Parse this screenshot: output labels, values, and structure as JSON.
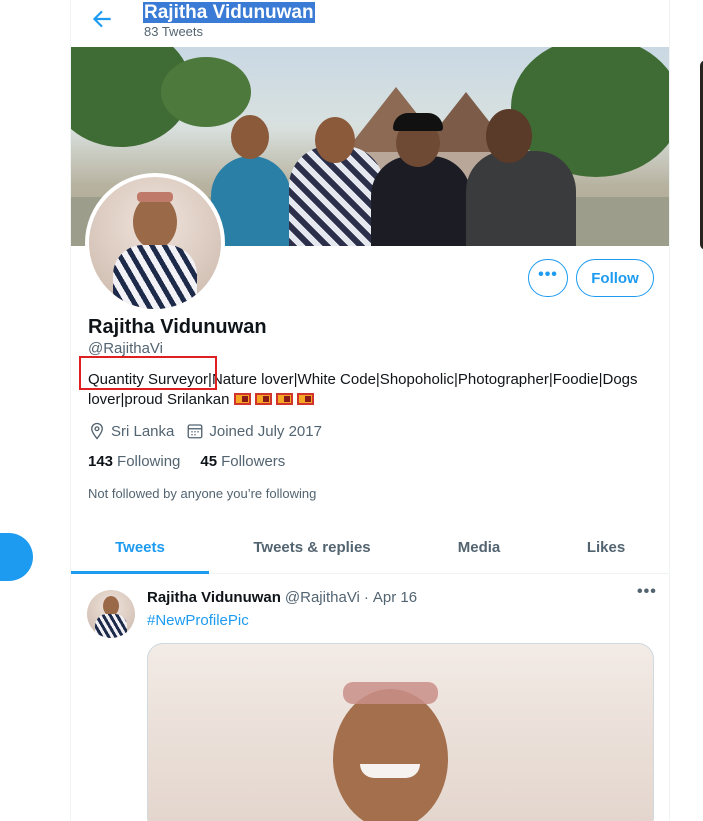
{
  "header": {
    "title": "Rajitha Vidunuwan",
    "subtitle": "83 Tweets"
  },
  "profile": {
    "name": "Rajitha Vidunuwan",
    "handle": "@RajithaVi",
    "bio_text": "Quantity Surveyor|Nature lover|White Code|Shopoholic|Photographer|Foodie|Dogs lover|proud Srilankan",
    "bio_flags_count": 4,
    "location": "Sri Lanka",
    "joined": "Joined July 2017",
    "following_count": "143",
    "following_label": "Following",
    "followers_count": "45",
    "followers_label": "Followers",
    "not_followed_note": "Not followed by anyone you’re following",
    "follow_button": "Follow",
    "more_button": "•••"
  },
  "tabs": [
    {
      "label": "Tweets",
      "active": true
    },
    {
      "label": "Tweets & replies",
      "active": false
    },
    {
      "label": "Media",
      "active": false
    },
    {
      "label": "Likes",
      "active": false
    }
  ],
  "tweet": {
    "author_name": "Rajitha Vidunuwan",
    "author_handle": "@RajithaVi",
    "separator": "·",
    "date": "Apr 16",
    "more": "•••",
    "text": "#NewProfilePic"
  },
  "icons": {
    "back": "arrow-left-icon",
    "location": "location-pin-icon",
    "calendar": "calendar-icon"
  },
  "colors": {
    "accent": "#1d9bf0",
    "highlight_box": "#e02020",
    "title_selection": "#3a7bd5"
  }
}
